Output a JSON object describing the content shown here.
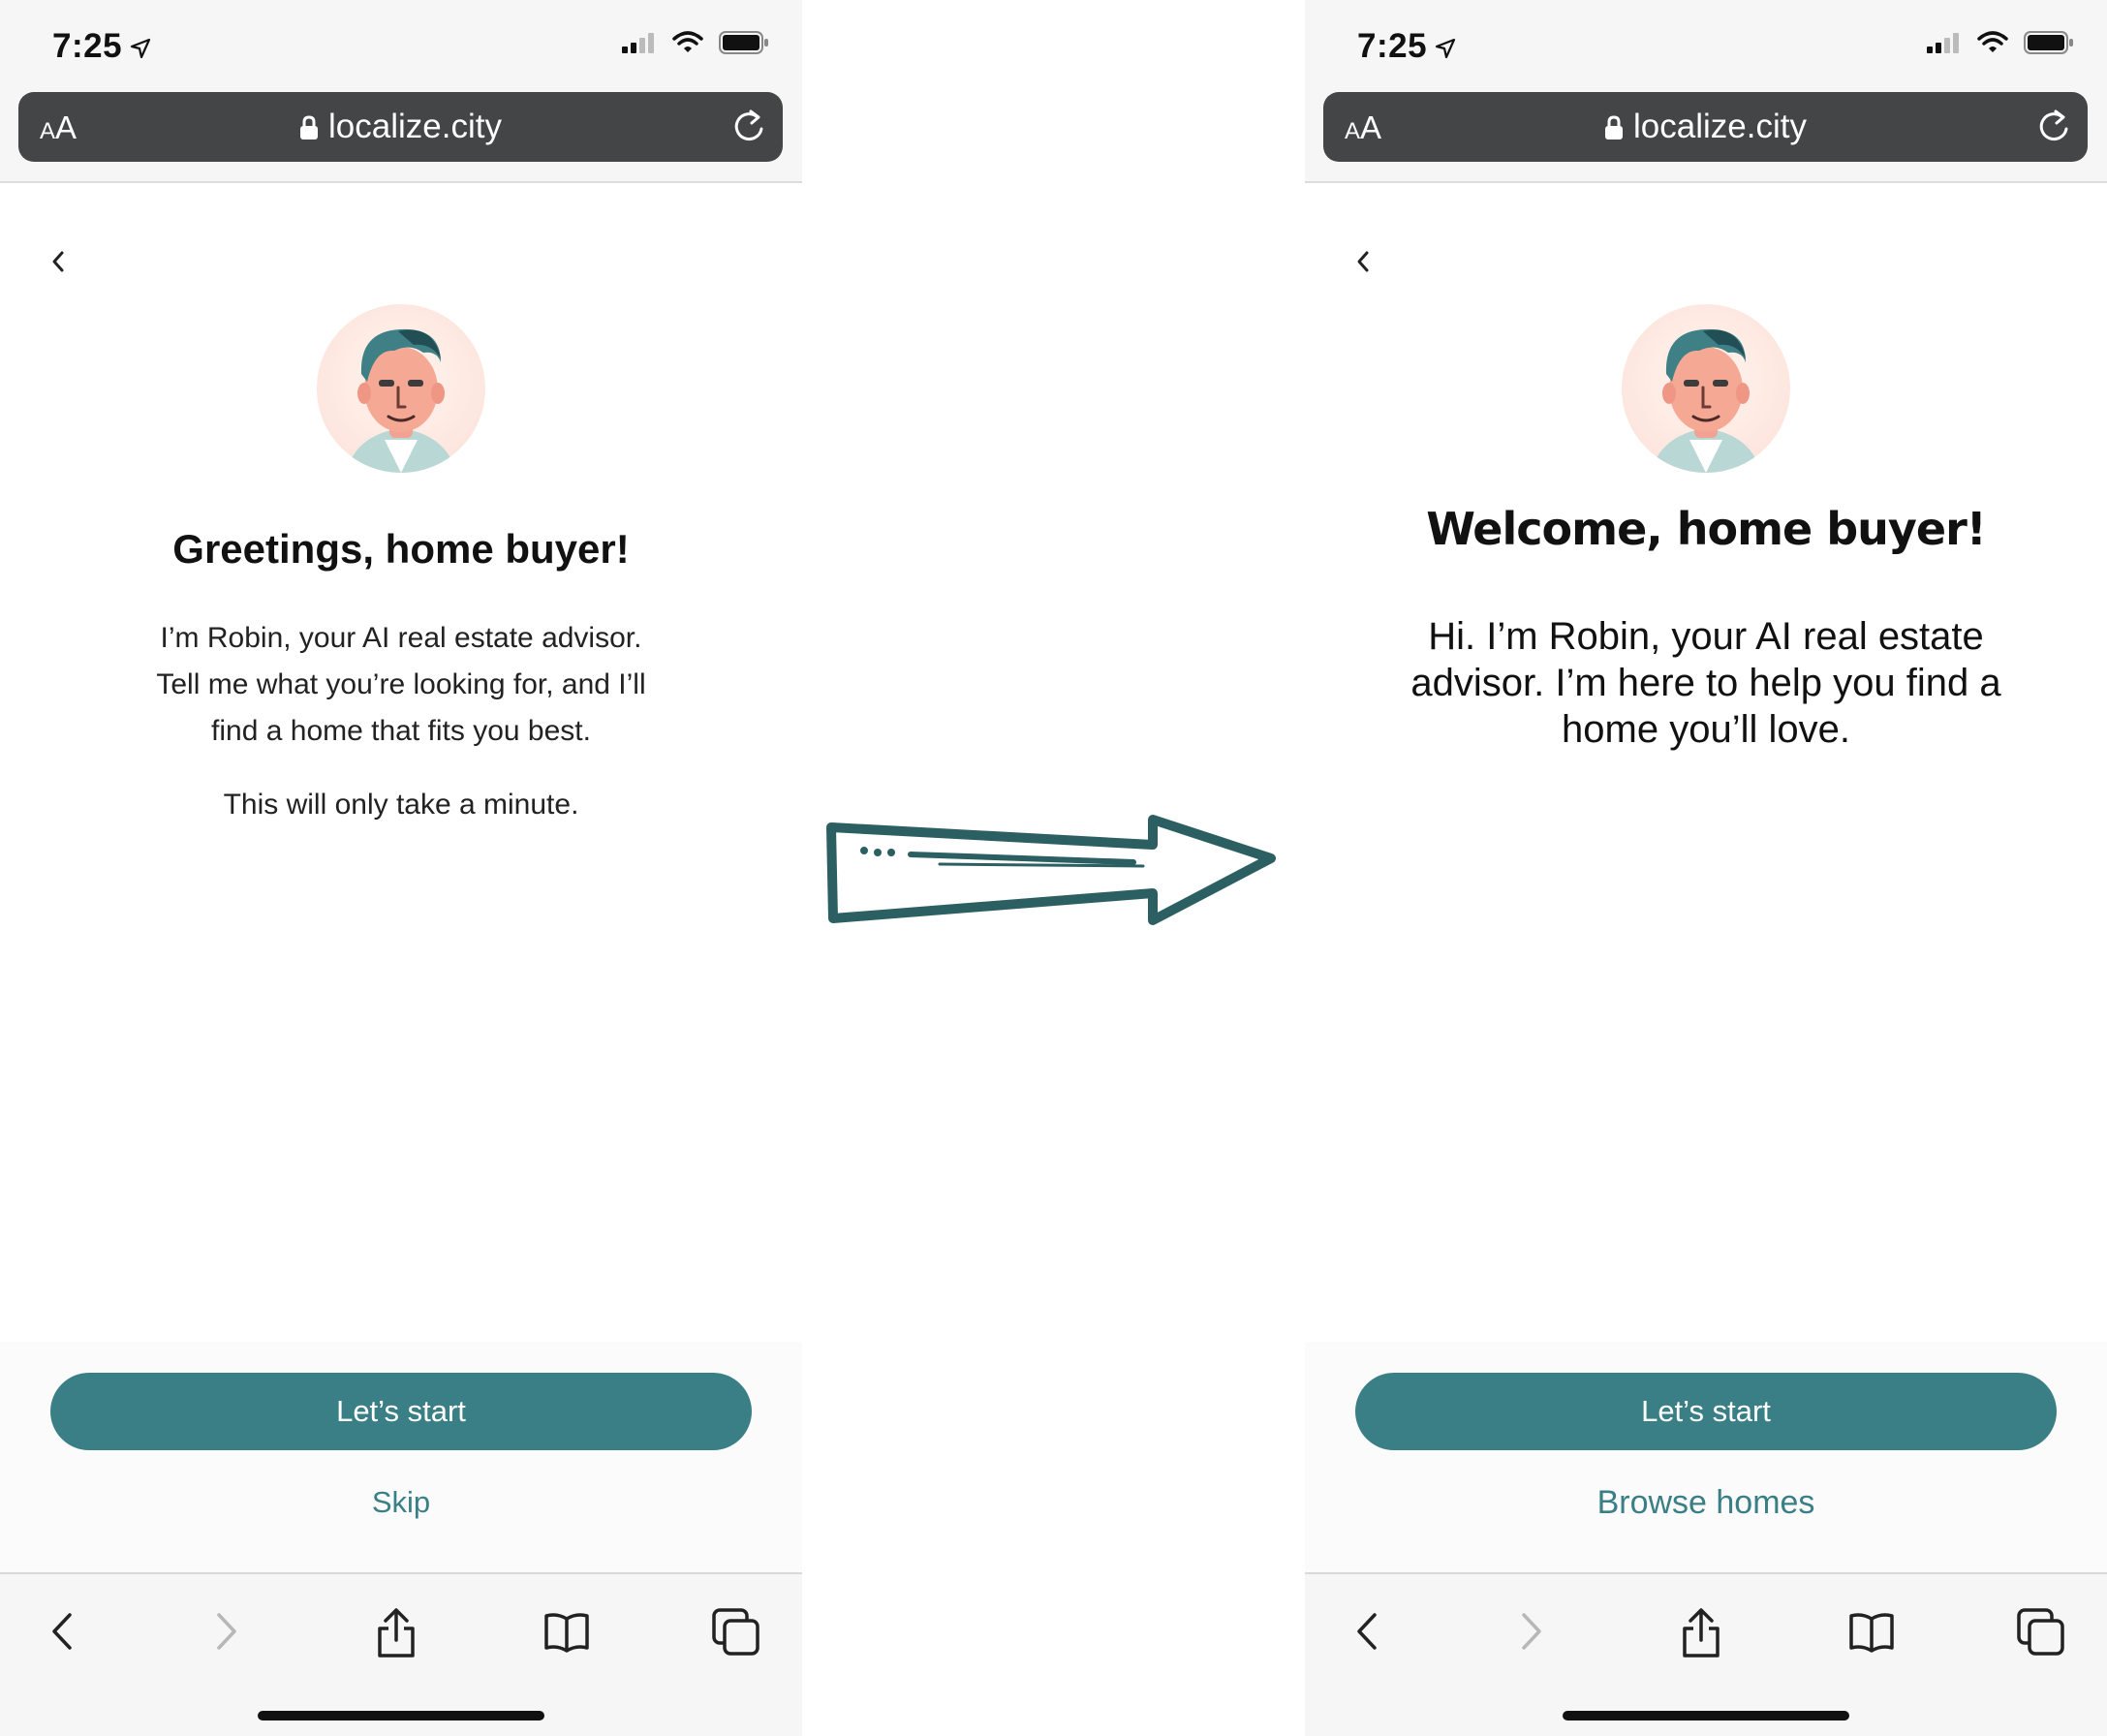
{
  "left": {
    "status": {
      "time": "7:25"
    },
    "address_bar": {
      "aa_small": "A",
      "aa_large": "A",
      "url": "localize.city"
    },
    "heading": "Greetings, home buyer!",
    "body": "I’m Robin, your AI real estate advisor. Tell me what you’re looking for, and I’ll find a home that fits you best.",
    "body_secondary": "This will only take a minute.",
    "primary_button": "Let’s start",
    "secondary_link": "Skip"
  },
  "right": {
    "status": {
      "time": "7:25"
    },
    "address_bar": {
      "aa_small": "A",
      "aa_large": "A",
      "url": "localize.city"
    },
    "heading": "Welcome, home buyer!",
    "body": "Hi. I’m Robin, your AI real estate advisor. I’m here to help you find a home you’ll love.",
    "primary_button": "Let’s start",
    "secondary_link": "Browse homes"
  },
  "colors": {
    "accent": "#397f85",
    "url_bar": "#444546",
    "arrow": "#2c5f62"
  }
}
